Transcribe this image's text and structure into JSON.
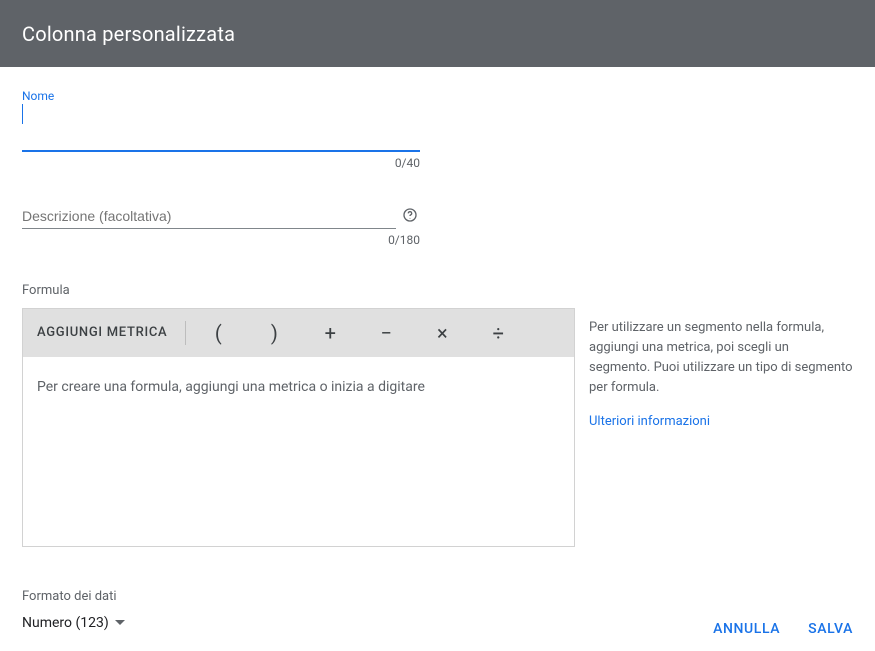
{
  "header": {
    "title": "Colonna personalizzata"
  },
  "name_field": {
    "label": "Nome",
    "value": "",
    "counter": "0/40"
  },
  "desc_field": {
    "label": "Descrizione (facoltativa)",
    "value": "",
    "counter": "0/180"
  },
  "formula": {
    "label": "Formula",
    "add_metric_label": "AGGIUNGI METRICA",
    "ops": {
      "open": "(",
      "close": ")",
      "plus": "+",
      "minus": "−",
      "mult": "×",
      "div": "÷"
    },
    "placeholder": "Per creare una formula, aggiungi una metrica o inizia a digitare"
  },
  "side": {
    "text": "Per utilizzare un segmento nella formula, aggiungi una metrica, poi scegli un segmento. Puoi utilizzare un tipo di segmento per formula.",
    "link": "Ulteriori informazioni"
  },
  "format": {
    "label": "Formato dei dati",
    "selected": "Numero (123)"
  },
  "footer": {
    "cancel": "ANNULLA",
    "save": "SALVA"
  }
}
